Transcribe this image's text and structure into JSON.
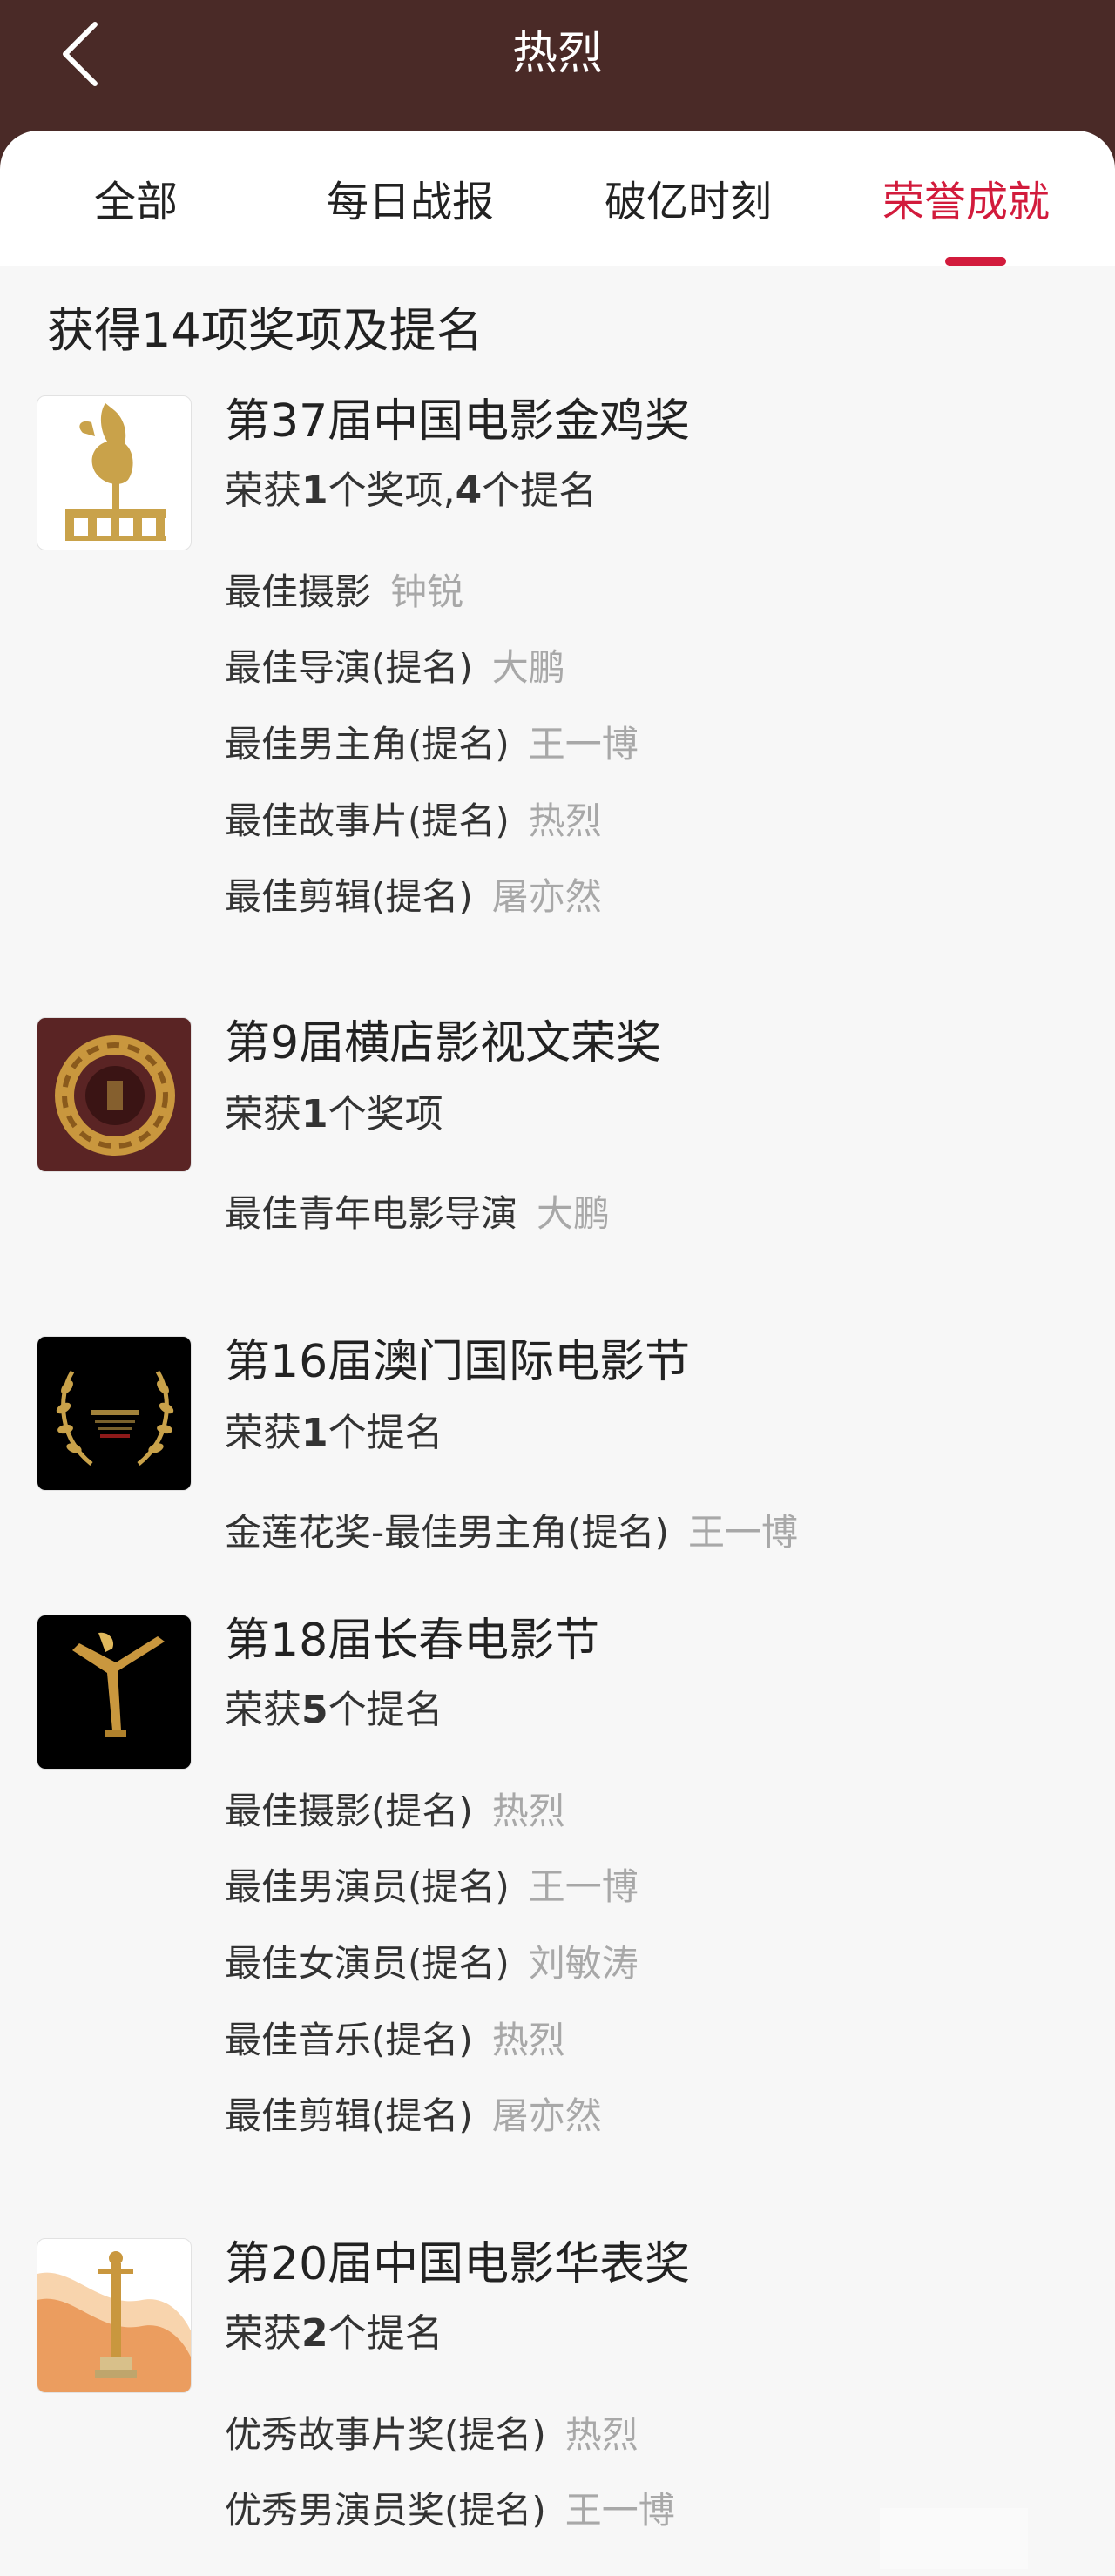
{
  "header": {
    "title": "热烈",
    "back_icon": "chevron-left-icon"
  },
  "tabs": [
    {
      "label": "全部"
    },
    {
      "label": "每日战报"
    },
    {
      "label": "破亿时刻"
    },
    {
      "label": "荣誉成就",
      "active": true
    }
  ],
  "summary": "获得14项奖项及提名",
  "colors": {
    "header_bg": "#4a2a27",
    "accent": "#d21b3c",
    "name_gray": "#a8a8a8"
  },
  "awards": [
    {
      "name": "第37届中国电影金鸡奖",
      "result": {
        "prefix": "荣获",
        "n1": "1",
        "mid": "个奖项,",
        "n2": "4",
        "suffix": "个提名"
      },
      "logo_icon": "golden-rooster-trophy-icon",
      "items": [
        {
          "category": "最佳摄影",
          "person": "钟锐"
        },
        {
          "category": "最佳导演(提名)",
          "person": "大鹏"
        },
        {
          "category": "最佳男主角(提名)",
          "person": "王一博"
        },
        {
          "category": "最佳故事片(提名)",
          "person": "热烈"
        },
        {
          "category": "最佳剪辑(提名)",
          "person": "屠亦然"
        }
      ]
    },
    {
      "name": "第9届横店影视文荣奖",
      "result": {
        "prefix": "荣获",
        "n1": "1",
        "mid": "个奖项"
      },
      "logo_icon": "hengdian-trophy-icon",
      "items": [
        {
          "category": "最佳青年电影导演",
          "person": "大鹏"
        }
      ]
    },
    {
      "name": "第16届澳门国际电影节",
      "result": {
        "prefix": "荣获",
        "n1": "1",
        "mid": "个提名"
      },
      "logo_icon": "macau-laurel-icon",
      "items": [
        {
          "category": "金莲花奖-最佳男主角(提名)",
          "person": "王一博"
        }
      ]
    },
    {
      "name": "第18届长春电影节",
      "result": {
        "prefix": "荣获",
        "n1": "5",
        "mid": "个提名"
      },
      "logo_icon": "changchun-trophy-icon",
      "items": [
        {
          "category": "最佳摄影(提名)",
          "person": "热烈"
        },
        {
          "category": "最佳男演员(提名)",
          "person": "王一博"
        },
        {
          "category": "最佳女演员(提名)",
          "person": "刘敏涛"
        },
        {
          "category": "最佳音乐(提名)",
          "person": "热烈"
        },
        {
          "category": "最佳剪辑(提名)",
          "person": "屠亦然"
        }
      ]
    },
    {
      "name": "第20届中国电影华表奖",
      "result": {
        "prefix": "荣获",
        "n1": "2",
        "mid": "个提名"
      },
      "logo_icon": "huabiao-pillar-icon",
      "items": [
        {
          "category": "优秀故事片奖(提名)",
          "person": "热烈"
        },
        {
          "category": "优秀男演员奖(提名)",
          "person": "王一博"
        }
      ]
    }
  ]
}
